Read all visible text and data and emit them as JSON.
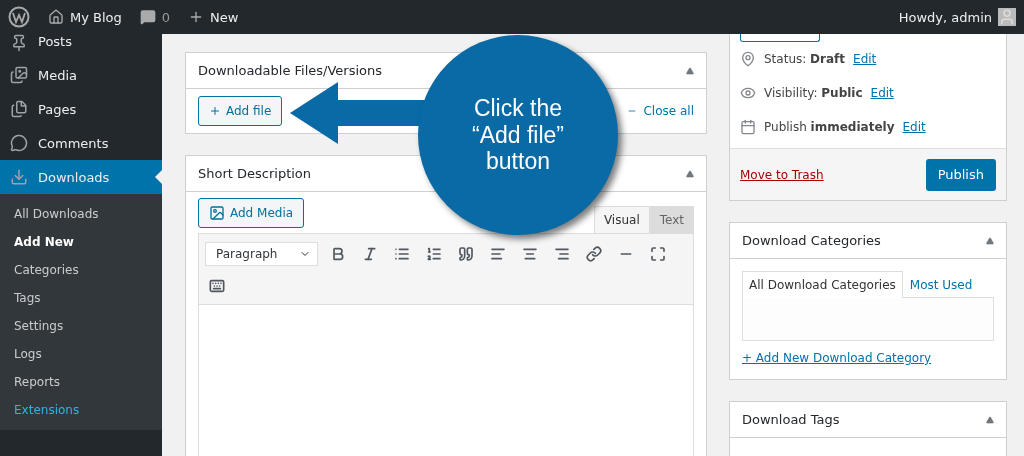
{
  "admin_bar": {
    "site": "My Blog",
    "comments": "0",
    "new": "New",
    "greeting": "Howdy, admin"
  },
  "sidebar": {
    "items": [
      {
        "label": "Posts",
        "selected": false
      },
      {
        "label": "Media",
        "selected": false
      },
      {
        "label": "Pages",
        "selected": false
      },
      {
        "label": "Comments",
        "selected": false
      },
      {
        "label": "Downloads",
        "selected": true
      }
    ],
    "submenu": [
      {
        "label": "All Downloads",
        "selected": false,
        "kind": "normal"
      },
      {
        "label": "Add New",
        "selected": true,
        "kind": "normal"
      },
      {
        "label": "Categories",
        "selected": false,
        "kind": "normal"
      },
      {
        "label": "Tags",
        "selected": false,
        "kind": "normal"
      },
      {
        "label": "Settings",
        "selected": false,
        "kind": "normal"
      },
      {
        "label": "Logs",
        "selected": false,
        "kind": "normal"
      },
      {
        "label": "Reports",
        "selected": false,
        "kind": "normal"
      },
      {
        "label": "Extensions",
        "selected": false,
        "kind": "highlight"
      }
    ]
  },
  "files_box": {
    "title": "Downloadable Files/Versions",
    "add_button": "Add file",
    "close_all": "Close all"
  },
  "description_box": {
    "title": "Short Description",
    "add_media": "Add Media",
    "format": "Paragraph",
    "tabs": [
      {
        "label": "Visual",
        "selected": true
      },
      {
        "label": "Text",
        "selected": false
      }
    ]
  },
  "publish_box": {
    "rows": [
      {
        "kind": "status",
        "label": "Status:",
        "value": "Draft",
        "link": "Edit"
      },
      {
        "kind": "visibility",
        "label": "Visibility:",
        "value": "Public",
        "link": "Edit"
      },
      {
        "kind": "schedule",
        "label": "Publish",
        "value": "immediately",
        "link": "Edit"
      }
    ],
    "trash": "Move to Trash",
    "publish": "Publish"
  },
  "categories_box": {
    "title": "Download Categories",
    "tabs": [
      {
        "label": "All Download Categories",
        "selected": true
      },
      {
        "label": "Most Used",
        "selected": false
      }
    ],
    "add_link": "+ Add New Download Category"
  },
  "tags_box": {
    "title": "Download Tags"
  },
  "callout": {
    "text": "Click the “Add file” button"
  }
}
